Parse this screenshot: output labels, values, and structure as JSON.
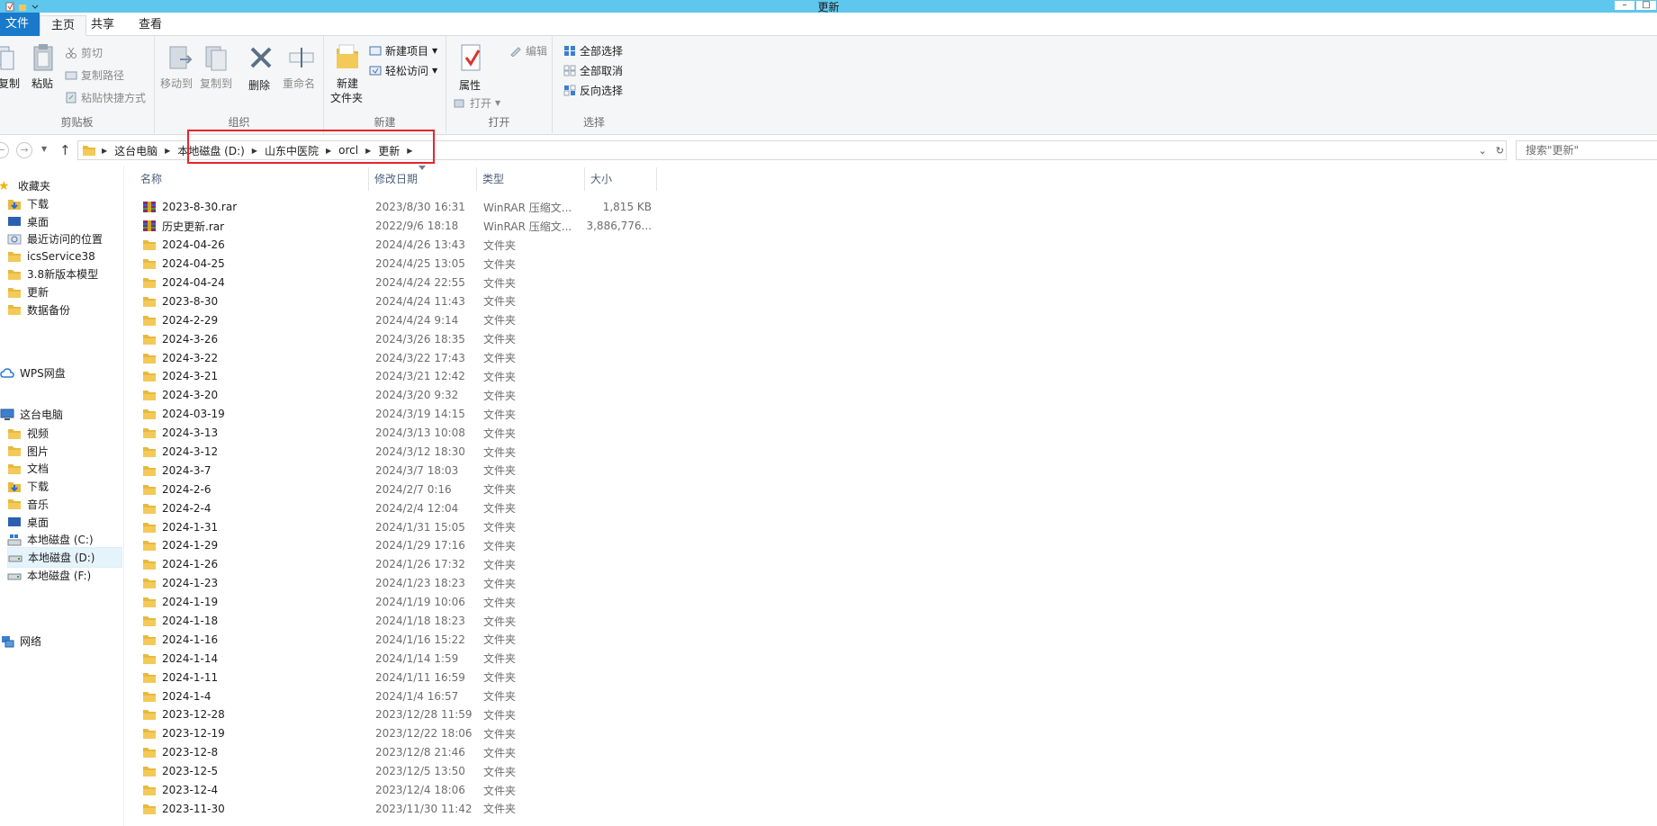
{
  "window": {
    "title": "更新"
  },
  "ribbon_tabs": {
    "file": "文件",
    "home": "主页",
    "share": "共享",
    "view": "查看"
  },
  "ribbon": {
    "clipboard": {
      "label": "剪贴板",
      "copy": "复制",
      "paste": "粘贴",
      "cut": "剪切",
      "copy_path": "复制路径",
      "paste_shortcut": "粘贴快捷方式"
    },
    "organize": {
      "label": "组织",
      "move_to": "移动到",
      "copy_to": "复制到",
      "delete": "删除",
      "rename": "重命名"
    },
    "new": {
      "label": "新建",
      "new_folder_line1": "新建",
      "new_folder_line2": "文件夹",
      "new_item": "新建项目",
      "easy_access": "轻松访问"
    },
    "open": {
      "label": "打开",
      "properties": "属性",
      "open": "打开",
      "edit": "编辑"
    },
    "select": {
      "label": "选择",
      "select_all": "全部选择",
      "select_none": "全部取消",
      "invert": "反向选择"
    }
  },
  "address": {
    "crumbs": [
      "这台电脑",
      "本地磁盘 (D:)",
      "山东中医院",
      "orcl",
      "更新"
    ],
    "search_placeholder": "搜索\"更新\""
  },
  "nav": {
    "favorites": "收藏夹",
    "fav_items": [
      "下载",
      "桌面",
      "最近访问的位置",
      "icsService38",
      "3.8新版本模型",
      "更新",
      "数据备份"
    ],
    "wps": "WPS网盘",
    "this_pc": "这台电脑",
    "pc_items": [
      "视频",
      "图片",
      "文档",
      "下载",
      "音乐",
      "桌面",
      "本地磁盘 (C:)",
      "本地磁盘 (D:)",
      "本地磁盘 (F:)"
    ],
    "network": "网络"
  },
  "columns": {
    "name": "名称",
    "date": "修改日期",
    "type": "类型",
    "size": "大小"
  },
  "files": [
    {
      "name": "2023-8-30.rar",
      "date": "2023/8/30 16:31",
      "type": "WinRAR 压缩文...",
      "size": "1,815 KB",
      "kind": "rar"
    },
    {
      "name": "历史更新.rar",
      "date": "2022/9/6 18:18",
      "type": "WinRAR 压缩文...",
      "size": "3,886,776...",
      "kind": "rar"
    },
    {
      "name": "2024-04-26",
      "date": "2024/4/26 13:43",
      "type": "文件夹",
      "size": "",
      "kind": "folder"
    },
    {
      "name": "2024-04-25",
      "date": "2024/4/25 13:05",
      "type": "文件夹",
      "size": "",
      "kind": "folder"
    },
    {
      "name": "2024-04-24",
      "date": "2024/4/24 22:55",
      "type": "文件夹",
      "size": "",
      "kind": "folder"
    },
    {
      "name": "2023-8-30",
      "date": "2024/4/24 11:43",
      "type": "文件夹",
      "size": "",
      "kind": "folder"
    },
    {
      "name": "2024-2-29",
      "date": "2024/4/24 9:14",
      "type": "文件夹",
      "size": "",
      "kind": "folder"
    },
    {
      "name": "2024-3-26",
      "date": "2024/3/26 18:35",
      "type": "文件夹",
      "size": "",
      "kind": "folder"
    },
    {
      "name": "2024-3-22",
      "date": "2024/3/22 17:43",
      "type": "文件夹",
      "size": "",
      "kind": "folder"
    },
    {
      "name": "2024-3-21",
      "date": "2024/3/21 12:42",
      "type": "文件夹",
      "size": "",
      "kind": "folder"
    },
    {
      "name": "2024-3-20",
      "date": "2024/3/20 9:32",
      "type": "文件夹",
      "size": "",
      "kind": "folder"
    },
    {
      "name": "2024-03-19",
      "date": "2024/3/19 14:15",
      "type": "文件夹",
      "size": "",
      "kind": "folder"
    },
    {
      "name": "2024-3-13",
      "date": "2024/3/13 10:08",
      "type": "文件夹",
      "size": "",
      "kind": "folder"
    },
    {
      "name": "2024-3-12",
      "date": "2024/3/12 18:30",
      "type": "文件夹",
      "size": "",
      "kind": "folder"
    },
    {
      "name": "2024-3-7",
      "date": "2024/3/7 18:03",
      "type": "文件夹",
      "size": "",
      "kind": "folder"
    },
    {
      "name": "2024-2-6",
      "date": "2024/2/7 0:16",
      "type": "文件夹",
      "size": "",
      "kind": "folder"
    },
    {
      "name": "2024-2-4",
      "date": "2024/2/4 12:04",
      "type": "文件夹",
      "size": "",
      "kind": "folder"
    },
    {
      "name": "2024-1-31",
      "date": "2024/1/31 15:05",
      "type": "文件夹",
      "size": "",
      "kind": "folder"
    },
    {
      "name": "2024-1-29",
      "date": "2024/1/29 17:16",
      "type": "文件夹",
      "size": "",
      "kind": "folder"
    },
    {
      "name": "2024-1-26",
      "date": "2024/1/26 17:32",
      "type": "文件夹",
      "size": "",
      "kind": "folder"
    },
    {
      "name": "2024-1-23",
      "date": "2024/1/23 18:23",
      "type": "文件夹",
      "size": "",
      "kind": "folder"
    },
    {
      "name": "2024-1-19",
      "date": "2024/1/19 10:06",
      "type": "文件夹",
      "size": "",
      "kind": "folder"
    },
    {
      "name": "2024-1-18",
      "date": "2024/1/18 18:23",
      "type": "文件夹",
      "size": "",
      "kind": "folder"
    },
    {
      "name": "2024-1-16",
      "date": "2024/1/16 15:22",
      "type": "文件夹",
      "size": "",
      "kind": "folder"
    },
    {
      "name": "2024-1-14",
      "date": "2024/1/14 1:59",
      "type": "文件夹",
      "size": "",
      "kind": "folder"
    },
    {
      "name": "2024-1-11",
      "date": "2024/1/11 16:59",
      "type": "文件夹",
      "size": "",
      "kind": "folder"
    },
    {
      "name": "2024-1-4",
      "date": "2024/1/4 16:57",
      "type": "文件夹",
      "size": "",
      "kind": "folder"
    },
    {
      "name": "2023-12-28",
      "date": "2023/12/28 11:59",
      "type": "文件夹",
      "size": "",
      "kind": "folder"
    },
    {
      "name": "2023-12-19",
      "date": "2023/12/22 18:06",
      "type": "文件夹",
      "size": "",
      "kind": "folder"
    },
    {
      "name": "2023-12-8",
      "date": "2023/12/8 21:46",
      "type": "文件夹",
      "size": "",
      "kind": "folder"
    },
    {
      "name": "2023-12-5",
      "date": "2023/12/5 13:50",
      "type": "文件夹",
      "size": "",
      "kind": "folder"
    },
    {
      "name": "2023-12-4",
      "date": "2023/12/4 18:06",
      "type": "文件夹",
      "size": "",
      "kind": "folder"
    },
    {
      "name": "2023-11-30",
      "date": "2023/11/30 11:42",
      "type": "文件夹",
      "size": "",
      "kind": "folder"
    }
  ],
  "colors": {
    "titlebar": "#5fc6ee",
    "file_tab": "#1979ca",
    "folder": "#e8b93f",
    "highlight_box": "#e8242b",
    "selected_nav": "#e5f3fb"
  }
}
